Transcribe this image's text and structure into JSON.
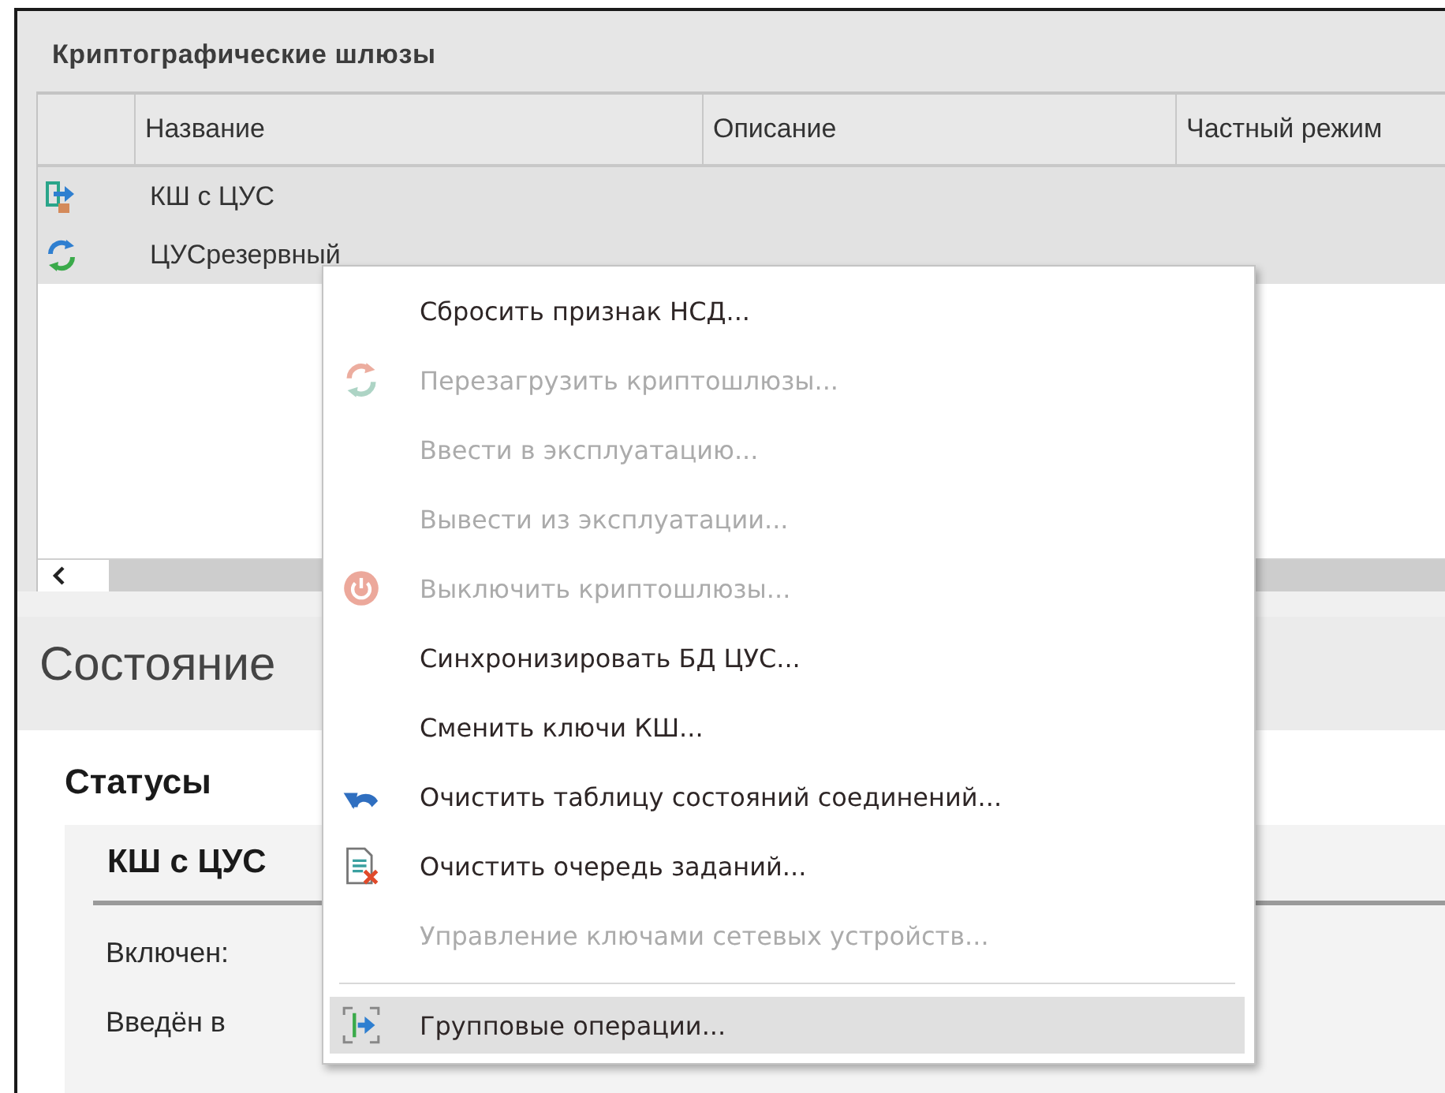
{
  "panel": {
    "title": "Криптографические шлюзы"
  },
  "table": {
    "columns": [
      "Название",
      "Описание",
      "Частный режим"
    ],
    "rows": [
      {
        "kind": "gateway",
        "name": "КШ с ЦУС",
        "selected": true
      },
      {
        "kind": "sync",
        "name": "ЦУСрезервный",
        "selected": true
      }
    ]
  },
  "state": {
    "title": "Состояние",
    "statuses_title": "Статусы",
    "card": {
      "title": "КШ с ЦУС",
      "fields": [
        {
          "label": "Включен:"
        },
        {
          "label": "Введён в"
        }
      ]
    }
  },
  "context_menu": {
    "items": [
      {
        "kind": "plain",
        "label": "Сбросить признак НСД...",
        "disabled": false,
        "selected": false
      },
      {
        "kind": "refresh",
        "label": "Перезагрузить криптошлюзы...",
        "disabled": true,
        "selected": false
      },
      {
        "kind": "plain",
        "label": "Ввести в эксплуатацию...",
        "disabled": true,
        "selected": false
      },
      {
        "kind": "plain",
        "label": "Вывести из эксплуатации...",
        "disabled": true,
        "selected": false
      },
      {
        "kind": "power",
        "label": "Выключить криптошлюзы...",
        "disabled": true,
        "selected": false
      },
      {
        "kind": "plain",
        "label": "Синхронизировать БД ЦУС...",
        "disabled": false,
        "selected": false
      },
      {
        "kind": "plain",
        "label": "Сменить ключи КШ...",
        "disabled": false,
        "selected": false
      },
      {
        "kind": "undo",
        "label": "Очистить таблицу состояний соединений...",
        "disabled": false,
        "selected": false
      },
      {
        "kind": "queue",
        "label": "Очистить очередь заданий...",
        "disabled": false,
        "selected": false
      },
      {
        "kind": "plain",
        "label": "Управление ключами сетевых устройств...",
        "disabled": true,
        "selected": false
      },
      {
        "kind": "separator"
      },
      {
        "kind": "group",
        "label": "Групповые операции...",
        "disabled": false,
        "selected": true
      }
    ]
  }
}
